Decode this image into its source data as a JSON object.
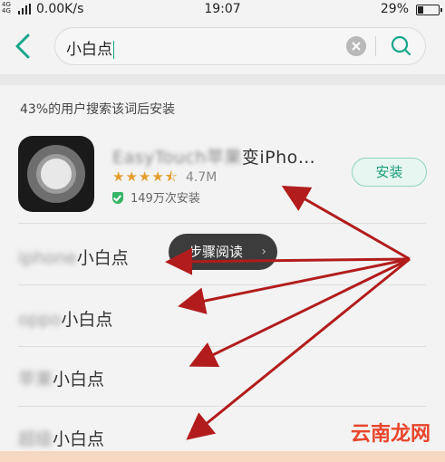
{
  "status_bar": {
    "signal_label": "4G\n4G",
    "net_speed": "0.00K/s",
    "time": "19:07",
    "battery": "29%"
  },
  "search": {
    "query": "小白点",
    "back_icon": "chevron-left-icon",
    "clear_icon": "clear-x-icon",
    "search_icon": "search-icon",
    "accent_color": "#16a589"
  },
  "hint_text": "43%的用户搜索该词后安装",
  "app": {
    "name_prefix_blurred": "EasyTouch苹果",
    "name_visible": "变iPho…",
    "stars": "★★★★⯪",
    "rating_value": "4.7M",
    "installs": "149万次安装",
    "install_label": "安装"
  },
  "suggestions": [
    {
      "blurred": "iphone",
      "visible": "小白点"
    },
    {
      "blurred": "oppo",
      "visible": "小白点"
    },
    {
      "blurred": "苹果",
      "visible": "小白点"
    },
    {
      "blurred": "超级",
      "visible": "小白点"
    }
  ],
  "overlay": {
    "label": "步骤阅读",
    "chevron": "›"
  },
  "watermark": "云南龙网",
  "colors": {
    "arrow": "#b21c1c",
    "install_text": "#1a9e7a",
    "stars": "#e59d2b",
    "verified": "#35b566"
  }
}
